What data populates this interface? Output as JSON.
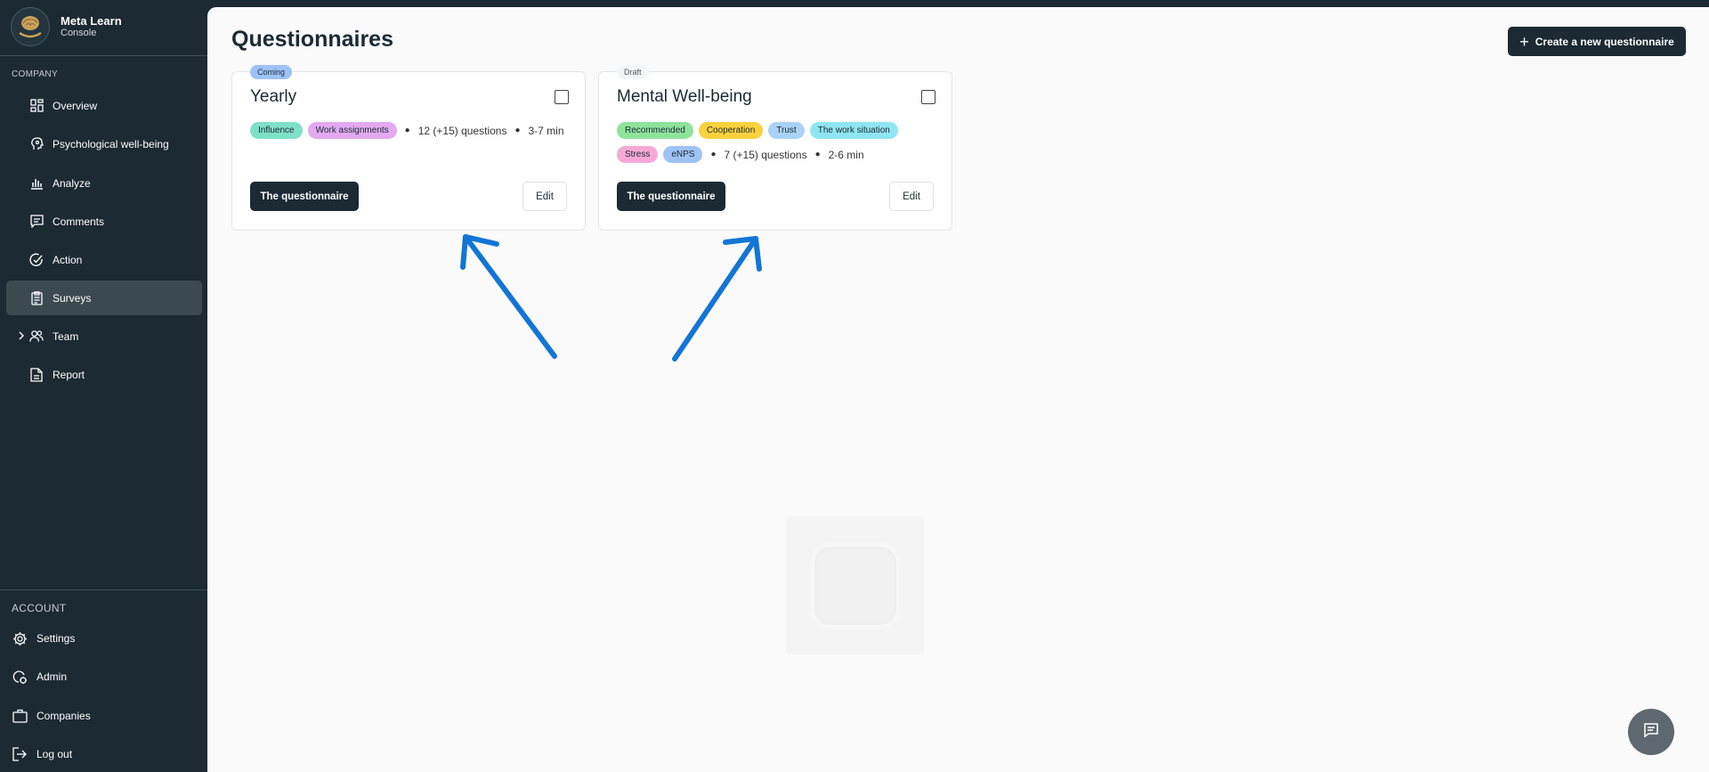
{
  "brand": {
    "name": "Meta Learn",
    "subtitle": "Console"
  },
  "sidebar": {
    "company_label": "COMPANY",
    "items": [
      {
        "label": "Overview",
        "icon": "grid-icon"
      },
      {
        "label": "Psychological well-being",
        "icon": "head-icon"
      },
      {
        "label": "Analyze",
        "icon": "bar-chart-icon"
      },
      {
        "label": "Comments",
        "icon": "comment-icon"
      },
      {
        "label": "Action",
        "icon": "check-circle-icon"
      },
      {
        "label": "Surveys",
        "icon": "clipboard-icon",
        "active": true
      },
      {
        "label": "Team",
        "icon": "users-icon",
        "expandable": true
      },
      {
        "label": "Report",
        "icon": "document-icon"
      }
    ],
    "account_label": "ACCOUNT",
    "account_items": [
      {
        "label": "Settings",
        "icon": "gear-icon"
      },
      {
        "label": "Admin",
        "icon": "admin-icon"
      },
      {
        "label": "Companies",
        "icon": "briefcase-icon"
      },
      {
        "label": "Log out",
        "icon": "logout-icon"
      }
    ]
  },
  "header": {
    "title": "Questionnaires",
    "create_label": "Create a new questionnaire"
  },
  "cards": [
    {
      "status": "Coming",
      "title": "Yearly",
      "tags": [
        {
          "label": "Influence",
          "color": "#7fe0c8"
        },
        {
          "label": "Work assignments",
          "color": "#e3a9f0"
        }
      ],
      "questions": "12 (+15) questions",
      "duration": "3-7 min",
      "primary_label": "The questionnaire",
      "edit_label": "Edit"
    },
    {
      "status": "Draft",
      "title": "Mental Well-being",
      "tags": [
        {
          "label": "Recommended",
          "color": "#8fe39b"
        },
        {
          "label": "Cooperation",
          "color": "#fbd13d"
        },
        {
          "label": "Trust",
          "color": "#a9d2f6"
        },
        {
          "label": "The work situation",
          "color": "#8fe6f2"
        },
        {
          "label": "Stress",
          "color": "#f7a9d6"
        },
        {
          "label": "eNPS",
          "color": "#9ec2f5"
        }
      ],
      "questions": "7 (+15) questions",
      "duration": "2-6 min",
      "primary_label": "The questionnaire",
      "edit_label": "Edit"
    }
  ],
  "colors": {
    "sidebar_bg": "#1b2a33",
    "active_bg": "#3b4951",
    "arrow": "#1275d6",
    "main_bg": "#fafafa"
  },
  "chat": {
    "icon": "chat-icon"
  }
}
